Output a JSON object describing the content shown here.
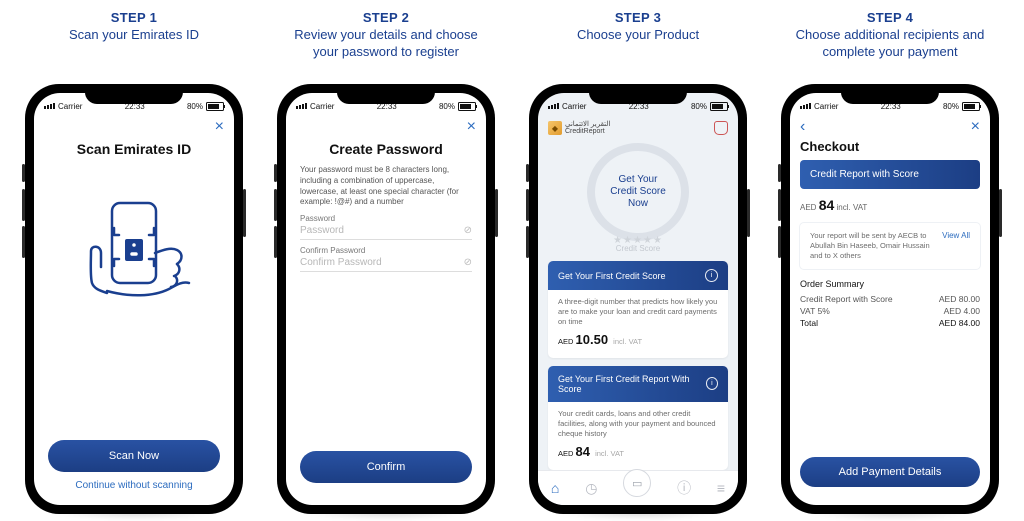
{
  "columns": [
    {
      "step": "STEP 1",
      "sub": "Scan your Emirates ID"
    },
    {
      "step": "STEP 2",
      "sub": "Review your details and choose your password to register"
    },
    {
      "step": "STEP 3",
      "sub": "Choose your Product"
    },
    {
      "step": "STEP 4",
      "sub": "Choose additional recipients and complete your payment"
    }
  ],
  "status": {
    "carrier": "Carrier",
    "time": "22:33",
    "battery": "80%"
  },
  "screen1": {
    "title": "Scan Emirates ID",
    "scan_btn": "Scan Now",
    "skip_link": "Continue without scanning"
  },
  "screen2": {
    "title": "Create Password",
    "note": "Your password must be 8 characters long, including a combination of uppercase, lowercase, at least one special character (for example: !@#) and a number",
    "pw_label": "Password",
    "pw_placeholder": "Password",
    "cpw_label": "Confirm Password",
    "cpw_placeholder": "Confirm Password",
    "confirm_btn": "Confirm"
  },
  "screen3": {
    "brand_ar": "التقرير الائتماني",
    "brand_en": "CreditReport",
    "halo_line1": "Get Your",
    "halo_line2": "Credit Score",
    "halo_line3": "Now",
    "stars_label": "Credit Score",
    "card1": {
      "title": "Get Your First Credit Score",
      "desc": "A three-digit number that predicts how likely you are to make your loan and credit card payments on time",
      "currency": "AED",
      "amount": "10.50",
      "vat": "incl. VAT"
    },
    "card2": {
      "title": "Get Your First Credit Report With Score",
      "desc": "Your credit cards, loans and other credit facilities, along with your payment and bounced cheque history",
      "currency": "AED",
      "amount": "84",
      "vat": "incl. VAT"
    }
  },
  "screen4": {
    "title": "Checkout",
    "head": "Credit Report with Score",
    "currency": "AED",
    "amount": "84",
    "vat": "incl. VAT",
    "recipients": "Your report will be sent by AECB to Abullah Bin Haseeb, Omair Hussain and to X others",
    "view_all": "View All",
    "order_summary_title": "Order Summary",
    "rows": [
      {
        "label": "Credit Report with Score",
        "value": "AED 80.00"
      },
      {
        "label": "VAT 5%",
        "value": "AED 4.00"
      },
      {
        "label": "Total",
        "value": "AED 84.00"
      }
    ],
    "pay_btn": "Add Payment Details"
  }
}
